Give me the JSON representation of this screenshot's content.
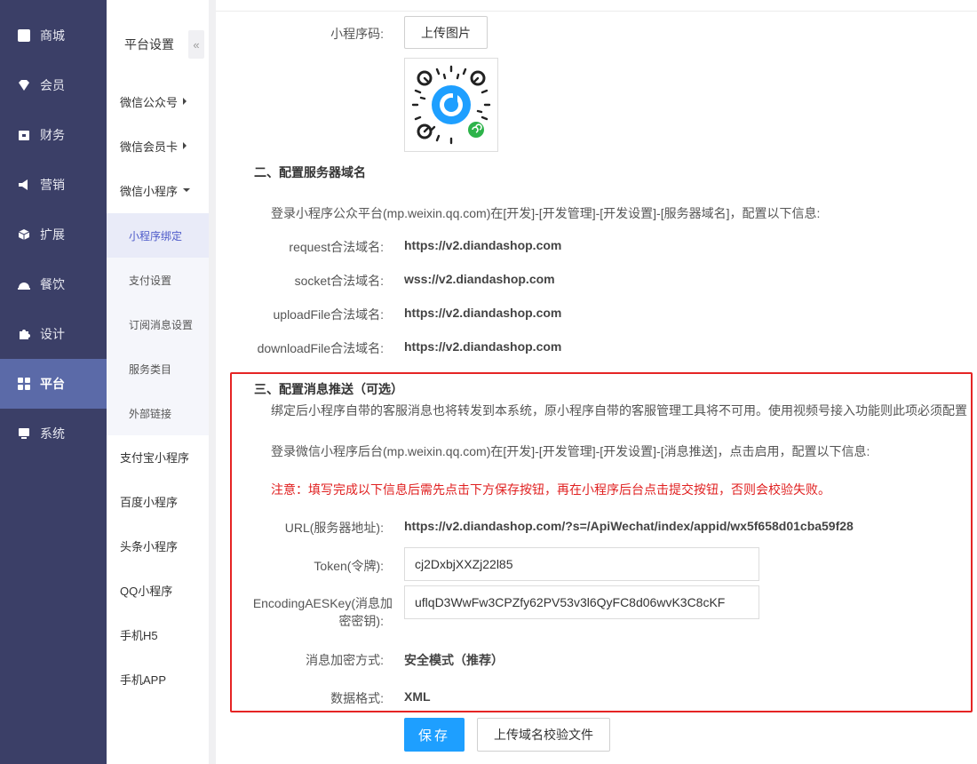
{
  "nav1": {
    "items": [
      {
        "label": "商城",
        "icon": "shop-icon"
      },
      {
        "label": "会员",
        "icon": "member-icon"
      },
      {
        "label": "财务",
        "icon": "finance-icon"
      },
      {
        "label": "营销",
        "icon": "megaphone-icon"
      },
      {
        "label": "扩展",
        "icon": "cube-icon"
      },
      {
        "label": "餐饮",
        "icon": "dining-icon"
      },
      {
        "label": "设计",
        "icon": "puzzle-icon"
      },
      {
        "label": "平台",
        "icon": "grid-icon",
        "active": true
      },
      {
        "label": "系统",
        "icon": "monitor-icon"
      }
    ]
  },
  "nav2": {
    "title": "平台设置",
    "collapse": "«",
    "items": {
      "wx_official": "微信公众号",
      "wx_card": "微信会员卡",
      "wx_mini": "微信小程序",
      "sub_bind": "小程序绑定",
      "sub_pay": "支付设置",
      "sub_subscribe": "订阅消息设置",
      "sub_category": "服务类目",
      "sub_link": "外部链接",
      "alipay": "支付宝小程序",
      "baidu": "百度小程序",
      "toutiao": "头条小程序",
      "qq": "QQ小程序",
      "h5": "手机H5",
      "app": "手机APP"
    }
  },
  "form": {
    "qrcode_label": "小程序码:",
    "upload_image": "上传图片",
    "section2_title": "二、配置服务器域名",
    "section2_desc": "登录小程序公众平台(mp.weixin.qq.com)在[开发]-[开发管理]-[开发设置]-[服务器域名]，配置以下信息:",
    "request_label": "request合法域名:",
    "request_value": "https://v2.diandashop.com",
    "socket_label": "socket合法域名:",
    "socket_value": "wss://v2.diandashop.com",
    "upload_label": "uploadFile合法域名:",
    "upload_value": "https://v2.diandashop.com",
    "download_label": "downloadFile合法域名:",
    "download_value": "https://v2.diandashop.com",
    "section3_title": "三、配置消息推送（可选）",
    "section3_note": "绑定后小程序自带的客服消息也将转发到本系统，原小程序自带的客服管理工具将不可用。使用视频号接入功能则此项必须配置",
    "section3_desc": "登录微信小程序后台(mp.weixin.qq.com)在[开发]-[开发管理]-[开发设置]-[消息推送]，点击启用，配置以下信息:",
    "warning": "注意：填写完成以下信息后需先点击下方保存按钮，再在小程序后台点击提交按钮，否则会校验失败。",
    "url_label": "URL(服务器地址):",
    "url_value": "https://v2.diandashop.com/?s=/ApiWechat/index/appid/wx5f658d01cba59f28",
    "token_label": "Token(令牌):",
    "token_value": "cj2DxbjXXZj22l85",
    "aes_label_1": "EncodingAESKey(消息加",
    "aes_label_2": "密密钥):",
    "aes_value": "uflqD3WwFw3CPZfy62PV53v3l6QyFC8d06wvK3C8cKF",
    "encrypt_label": "消息加密方式:",
    "encrypt_value": "安全模式（推荐）",
    "format_label": "数据格式:",
    "format_value": "XML",
    "save_button": "保存",
    "upload_verify_button": "上传域名校验文件"
  },
  "colors": {
    "nav_bg": "#3b3f67",
    "nav_active": "#5b6aa8",
    "primary": "#1e9fff",
    "warning": "#e02020",
    "highlight_border": "#e52424"
  }
}
